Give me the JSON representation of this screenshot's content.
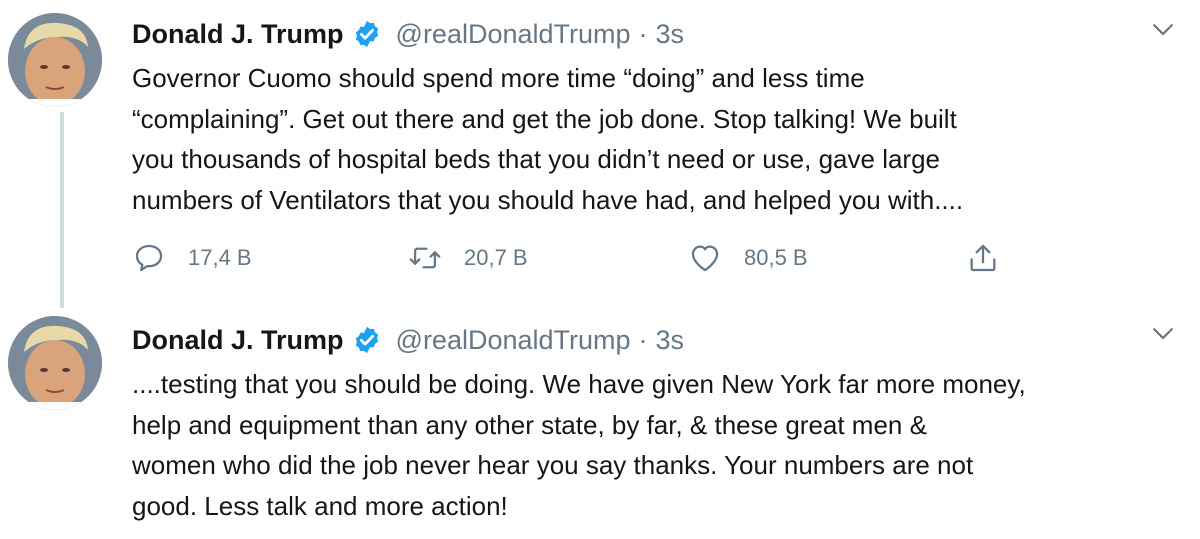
{
  "tweets": [
    {
      "author": "Donald J. Trump",
      "handle": "@realDonaldTrump",
      "separator": "·",
      "time": "3s",
      "lines": [
        "Governor Cuomo should spend more time “doing” and less time",
        "“complaining”. Get out there and get the job done. Stop talking! We built",
        "you thousands of hospital beds that you didn’t need or use, gave large",
        "numbers of Ventilators that you should have had, and helped you with...."
      ],
      "replies": "17,4 B",
      "retweets": "20,7 B",
      "likes": "80,5 B"
    },
    {
      "author": "Donald J. Trump",
      "handle": "@realDonaldTrump",
      "separator": "·",
      "time": "3s",
      "lines": [
        "....testing that you should be doing. We have given New York far more money,",
        "help and equipment than any other state, by far, & these great men &",
        "women who did the job never hear you say thanks. Your numbers are not",
        "good. Less talk and more action!"
      ]
    }
  ],
  "icons": {
    "verified": "verified-badge-icon",
    "caret": "chevron-down-icon",
    "reply": "reply-bubble-icon",
    "retweet": "retweet-icon",
    "like": "heart-icon",
    "share": "share-upload-icon"
  },
  "colors": {
    "verified_blue": "#1da1f2",
    "secondary_text": "#657786",
    "thread_line": "#cfd9de"
  }
}
